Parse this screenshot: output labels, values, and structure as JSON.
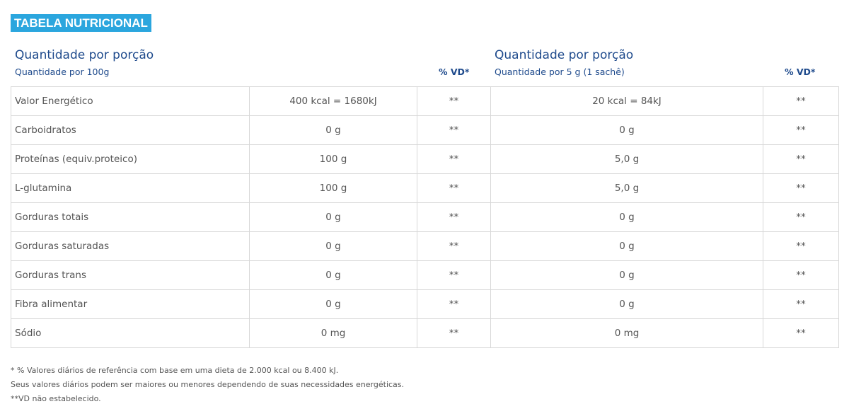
{
  "title": "TABELA NUTRICIONAL",
  "left_header": {
    "heading": "Quantidade por porção",
    "subheading": "Quantidade por 100g",
    "vd_label": "% VD*"
  },
  "right_header": {
    "heading": "Quantidade por porção",
    "subheading": "Quantidade por 5 g (1 sachê)",
    "vd_label": "% VD*"
  },
  "rows": [
    {
      "name": "Valor Energético",
      "per100": "400 kcal = 1680kJ",
      "vd1": "**",
      "perServing": "20 kcal = 84kJ",
      "vd2": "**"
    },
    {
      "name": "Carboidratos",
      "per100": "0 g",
      "vd1": "**",
      "perServing": "0 g",
      "vd2": "**"
    },
    {
      "name": "Proteínas (equiv.proteico)",
      "per100": "100 g",
      "vd1": "**",
      "perServing": "5,0 g",
      "vd2": "**"
    },
    {
      "name": "L-glutamina",
      "per100": "100 g",
      "vd1": "**",
      "perServing": "5,0 g",
      "vd2": "**"
    },
    {
      "name": "Gorduras totais",
      "per100": "0 g",
      "vd1": "**",
      "perServing": "0 g",
      "vd2": "**"
    },
    {
      "name": "Gorduras saturadas",
      "per100": "0 g",
      "vd1": "**",
      "perServing": "0 g",
      "vd2": "**"
    },
    {
      "name": "Gorduras trans",
      "per100": "0 g",
      "vd1": "**",
      "perServing": "0 g",
      "vd2": "**"
    },
    {
      "name": "Fibra alimentar",
      "per100": "0 g",
      "vd1": "**",
      "perServing": "0 g",
      "vd2": "**"
    },
    {
      "name": "Sódio",
      "per100": "0 mg",
      "vd1": "**",
      "perServing": "0 mg",
      "vd2": "**"
    }
  ],
  "footnotes": [
    "* % Valores diários de referência com base em uma dieta de 2.000 kcal ou 8.400 kJ.",
    "Seus valores diários podem ser maiores ou menores dependendo de suas necessidades energéticas.",
    "**VD não estabelecido."
  ]
}
